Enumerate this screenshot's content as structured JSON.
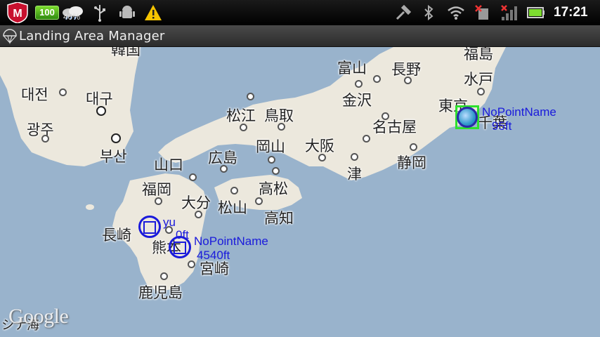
{
  "statusbar": {
    "battery_badge": "100",
    "weather_percent": "40%",
    "clock": "17:21",
    "icons": [
      "mcafee-icon",
      "battery-badge",
      "weather-icon",
      "usb-icon",
      "android-debug-icon",
      "warning-icon",
      "tool-icon",
      "bluetooth-icon",
      "wifi-icon",
      "no-sim-icon",
      "signal-icon",
      "battery-icon"
    ],
    "colors": {
      "warning": "#f5c400",
      "mcafee": "#c8102e",
      "battery_badge": "#4fb81e"
    }
  },
  "titlebar": {
    "title": "Landing Area Manager"
  },
  "map": {
    "cities": [
      {
        "id": "daejeon",
        "label": "대전"
      },
      {
        "id": "daegu",
        "label": "대구"
      },
      {
        "id": "gwangju",
        "label": "광주"
      },
      {
        "id": "busan",
        "label": "부산"
      },
      {
        "id": "korea",
        "label": "韓国"
      },
      {
        "id": "toyama",
        "label": "富山"
      },
      {
        "id": "nagano",
        "label": "長野"
      },
      {
        "id": "fukushima",
        "label": "福島"
      },
      {
        "id": "mito",
        "label": "水戸"
      },
      {
        "id": "kanazawa",
        "label": "金沢"
      },
      {
        "id": "matsue",
        "label": "松江"
      },
      {
        "id": "tottori",
        "label": "鳥取"
      },
      {
        "id": "tokyo",
        "label": "東京"
      },
      {
        "id": "chiba",
        "label": "千葉"
      },
      {
        "id": "nagoya",
        "label": "名古屋"
      },
      {
        "id": "yamaguchi",
        "label": "山口"
      },
      {
        "id": "hiroshima",
        "label": "広島"
      },
      {
        "id": "okayama",
        "label": "岡山"
      },
      {
        "id": "osaka",
        "label": "大阪"
      },
      {
        "id": "shizuoka",
        "label": "静岡"
      },
      {
        "id": "tsu",
        "label": "津"
      },
      {
        "id": "fukuoka",
        "label": "福岡"
      },
      {
        "id": "takamatsu",
        "label": "高松"
      },
      {
        "id": "oita",
        "label": "大分"
      },
      {
        "id": "matsuyama",
        "label": "松山"
      },
      {
        "id": "kochi",
        "label": "高知"
      },
      {
        "id": "nagasaki",
        "label": "長崎"
      },
      {
        "id": "kumamoto",
        "label": "熊本"
      },
      {
        "id": "miyazaki",
        "label": "宮崎"
      },
      {
        "id": "kagoshima",
        "label": "鹿児島"
      },
      {
        "id": "sea",
        "label": "シナ海"
      }
    ],
    "markers": [
      {
        "id": "yu",
        "name": "yu",
        "alt": "0ft"
      },
      {
        "id": "kumamoto-point",
        "name": "NoPointName",
        "alt": "4540ft"
      },
      {
        "id": "tokyo-point",
        "name": "NoPointName",
        "alt": "95ft"
      }
    ],
    "attribution": "Google",
    "colors": {
      "sea": "#99b3cc",
      "land": "#ece8dd",
      "marker": "#1a1adb",
      "gps_square": "#2ee02e"
    }
  }
}
